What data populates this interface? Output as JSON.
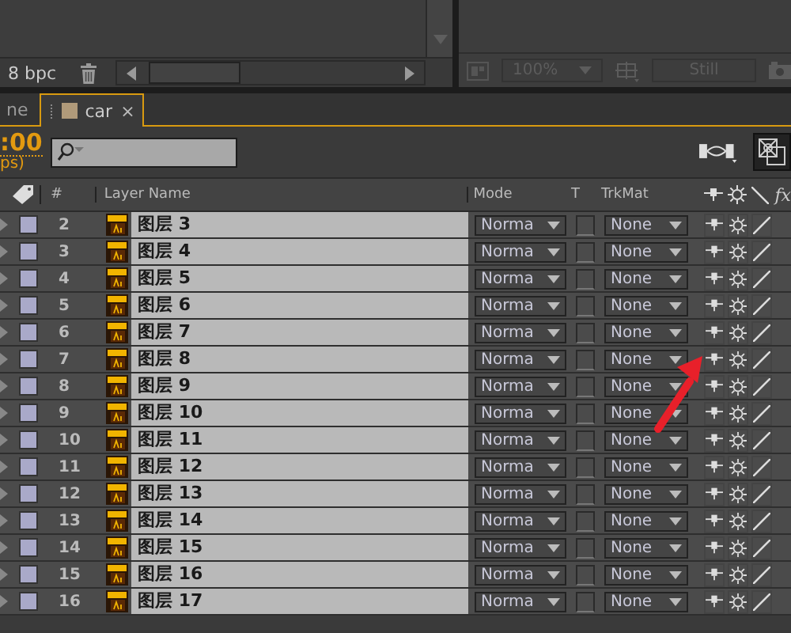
{
  "left_panel": {
    "bit_depth": "8 bpc"
  },
  "right_panel": {
    "zoom": "100%",
    "still": "Still"
  },
  "tabs": [
    {
      "label": "ne",
      "selected": false
    },
    {
      "label": "car",
      "selected": true,
      "close": "×"
    }
  ],
  "timecode": {
    "time": ":00",
    "fps": "ps)"
  },
  "columns": {
    "number": "#",
    "layer_name": "Layer Name",
    "mode": "Mode",
    "t": "T",
    "trkmat": "TrkMat",
    "fx": "fx"
  },
  "layers": [
    {
      "number": "2",
      "name": "图层 3",
      "mode": "Norma",
      "trkmat": "None",
      "preserve_transparency": false,
      "shy": false,
      "collapse": false,
      "best_quality": true
    },
    {
      "number": "3",
      "name": "图层 4",
      "mode": "Norma",
      "trkmat": "None",
      "preserve_transparency": false,
      "shy": false,
      "collapse": false,
      "best_quality": true
    },
    {
      "number": "4",
      "name": "图层 5",
      "mode": "Norma",
      "trkmat": "None",
      "preserve_transparency": false,
      "shy": false,
      "collapse": false,
      "best_quality": true
    },
    {
      "number": "5",
      "name": "图层 6",
      "mode": "Norma",
      "trkmat": "None",
      "preserve_transparency": false,
      "shy": false,
      "collapse": false,
      "best_quality": true
    },
    {
      "number": "6",
      "name": "图层 7",
      "mode": "Norma",
      "trkmat": "None",
      "preserve_transparency": false,
      "shy": false,
      "collapse": false,
      "best_quality": true
    },
    {
      "number": "7",
      "name": "图层 8",
      "mode": "Norma",
      "trkmat": "None",
      "preserve_transparency": false,
      "shy": false,
      "collapse": false,
      "best_quality": true
    },
    {
      "number": "8",
      "name": "图层 9",
      "mode": "Norma",
      "trkmat": "None",
      "preserve_transparency": false,
      "shy": false,
      "collapse": false,
      "best_quality": true
    },
    {
      "number": "9",
      "name": "图层 10",
      "mode": "Norma",
      "trkmat": "None",
      "preserve_transparency": false,
      "shy": false,
      "collapse": false,
      "best_quality": true
    },
    {
      "number": "10",
      "name": "图层 11",
      "mode": "Norma",
      "trkmat": "None",
      "preserve_transparency": false,
      "shy": false,
      "collapse": false,
      "best_quality": true
    },
    {
      "number": "11",
      "name": "图层 12",
      "mode": "Norma",
      "trkmat": "None",
      "preserve_transparency": false,
      "shy": false,
      "collapse": false,
      "best_quality": true
    },
    {
      "number": "12",
      "name": "图层 13",
      "mode": "Norma",
      "trkmat": "None",
      "preserve_transparency": false,
      "shy": false,
      "collapse": false,
      "best_quality": true
    },
    {
      "number": "13",
      "name": "图层 14",
      "mode": "Norma",
      "trkmat": "None",
      "preserve_transparency": false,
      "shy": false,
      "collapse": false,
      "best_quality": true
    },
    {
      "number": "14",
      "name": "图层 15",
      "mode": "Norma",
      "trkmat": "None",
      "preserve_transparency": false,
      "shy": false,
      "collapse": false,
      "best_quality": true
    },
    {
      "number": "15",
      "name": "图层 16",
      "mode": "Norma",
      "trkmat": "None",
      "preserve_transparency": false,
      "shy": false,
      "collapse": false,
      "best_quality": true
    },
    {
      "number": "16",
      "name": "图层 17",
      "mode": "Norma",
      "trkmat": "None",
      "preserve_transparency": false,
      "shy": false,
      "collapse": false,
      "best_quality": true
    }
  ]
}
